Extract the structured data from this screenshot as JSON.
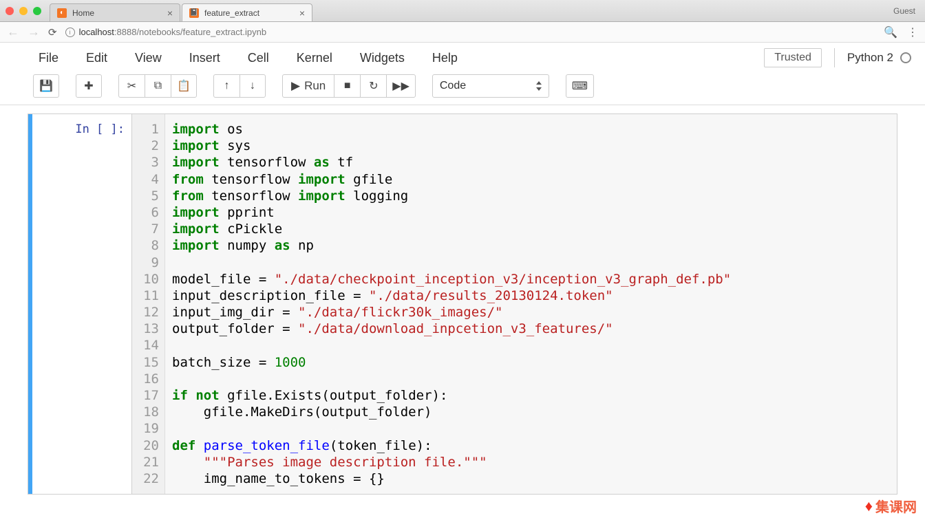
{
  "browser": {
    "tabs": [
      {
        "title": "Home",
        "active": false
      },
      {
        "title": "feature_extract",
        "active": true
      }
    ],
    "guest": "Guest",
    "url_host": "localhost",
    "url_port": ":8888",
    "url_path": "/notebooks/feature_extract.ipynb"
  },
  "menubar": {
    "items": [
      "File",
      "Edit",
      "View",
      "Insert",
      "Cell",
      "Kernel",
      "Widgets",
      "Help"
    ],
    "trusted": "Trusted",
    "kernel": "Python 2"
  },
  "toolbar": {
    "run_label": "Run",
    "celltype": "Code"
  },
  "cell": {
    "prompt": "In [ ]:",
    "line_count": 22,
    "code_tokens": [
      [
        [
          "kw",
          "import"
        ],
        [
          "",
          " os"
        ]
      ],
      [
        [
          "kw",
          "import"
        ],
        [
          "",
          " sys"
        ]
      ],
      [
        [
          "kw",
          "import"
        ],
        [
          "",
          " tensorflow "
        ],
        [
          "kw",
          "as"
        ],
        [
          "",
          " tf"
        ]
      ],
      [
        [
          "kw",
          "from"
        ],
        [
          "",
          " tensorflow "
        ],
        [
          "kw",
          "import"
        ],
        [
          "",
          " gfile"
        ]
      ],
      [
        [
          "kw",
          "from"
        ],
        [
          "",
          " tensorflow "
        ],
        [
          "kw",
          "import"
        ],
        [
          "",
          " logging"
        ]
      ],
      [
        [
          "kw",
          "import"
        ],
        [
          "",
          " pprint"
        ]
      ],
      [
        [
          "kw",
          "import"
        ],
        [
          "",
          " cPickle"
        ]
      ],
      [
        [
          "kw",
          "import"
        ],
        [
          "",
          " numpy "
        ],
        [
          "kw",
          "as"
        ],
        [
          "",
          " np"
        ]
      ],
      [],
      [
        [
          "",
          "model_file = "
        ],
        [
          "str",
          "\"./data/checkpoint_inception_v3/inception_v3_graph_def.pb\""
        ]
      ],
      [
        [
          "",
          "input_description_file = "
        ],
        [
          "str",
          "\"./data/results_20130124.token\""
        ]
      ],
      [
        [
          "",
          "input_img_dir = "
        ],
        [
          "str",
          "\"./data/flickr30k_images/\""
        ]
      ],
      [
        [
          "",
          "output_folder = "
        ],
        [
          "str",
          "\"./data/download_inpcetion_v3_features/\""
        ]
      ],
      [],
      [
        [
          "",
          "batch_size = "
        ],
        [
          "num",
          "1000"
        ]
      ],
      [],
      [
        [
          "kw",
          "if"
        ],
        [
          "",
          " "
        ],
        [
          "kw",
          "not"
        ],
        [
          "",
          " gfile.Exists(output_folder):"
        ]
      ],
      [
        [
          "",
          "    gfile.MakeDirs(output_folder)"
        ]
      ],
      [],
      [
        [
          "kw",
          "def"
        ],
        [
          "",
          " "
        ],
        [
          "def",
          "parse_token_file"
        ],
        [
          "",
          "(token_file):"
        ]
      ],
      [
        [
          "",
          "    "
        ],
        [
          "doc",
          "\"\"\"Parses image description file.\"\"\""
        ]
      ],
      [
        [
          "",
          "    img_name_to_tokens = {}"
        ]
      ]
    ]
  },
  "watermark": "集课网"
}
